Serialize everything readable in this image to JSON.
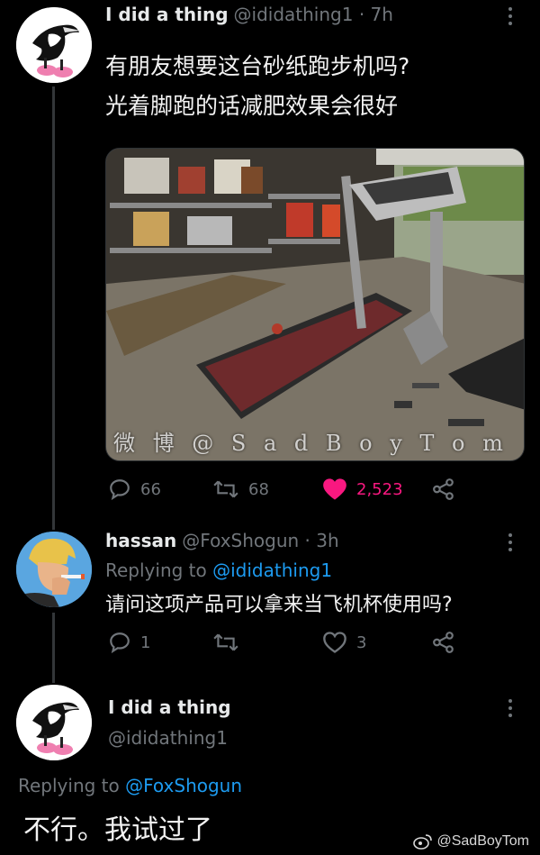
{
  "tweet1": {
    "display_name": "I did a thing",
    "handle_time": "@ididathing1 · 7h",
    "text_line1": "有朋友想要这台砂纸跑步机吗?",
    "text_line2": "光着脚跑的话减肥效果会很好",
    "watermark": "微 博 @ S a d B o y T o m",
    "replies": "66",
    "retweets": "68",
    "likes": "2,523",
    "like_color": "#f91880"
  },
  "tweet2": {
    "display_name": "hassan",
    "handle_time": "@FoxShogun · 3h",
    "replying_prefix": "Replying to ",
    "replying_mention": "@ididathing1",
    "text": "请问这项产品可以拿来当飞机杯使用吗?",
    "replies": "1",
    "retweets": "",
    "likes": "3"
  },
  "tweet3": {
    "display_name": "I did a thing",
    "handle": "@ididathing1",
    "replying_prefix": "Replying to ",
    "replying_mention": "@FoxShogun",
    "text": "不行。我试过了"
  },
  "footer": {
    "weibo_mark": "@SadBoyTom"
  },
  "colors": {
    "accent": "#1d9bf0",
    "muted": "#71767b",
    "like": "#f91880"
  }
}
